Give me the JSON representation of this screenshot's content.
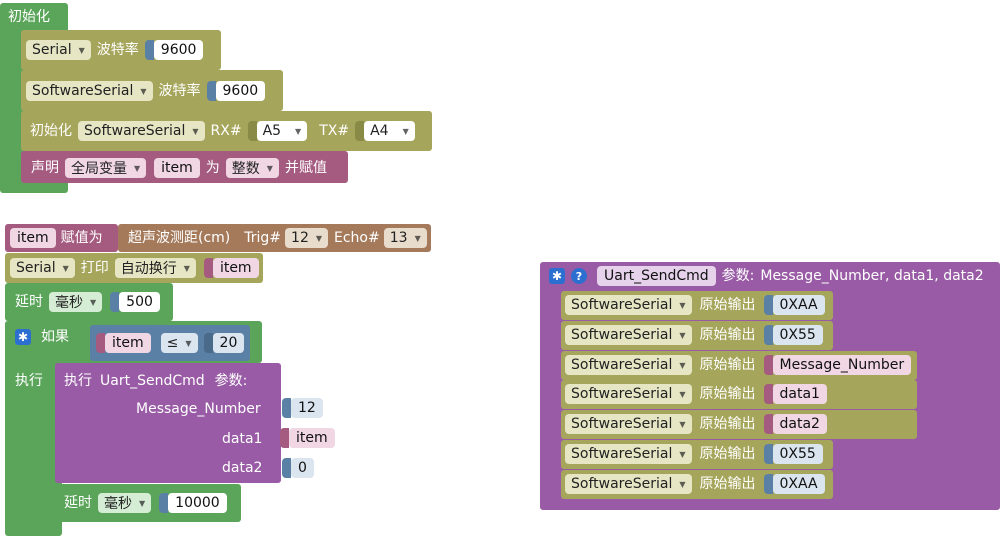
{
  "colors": {
    "green": "#5ba55b",
    "olive": "#a5a55b",
    "maroon": "#a55b80",
    "purple": "#995ba5",
    "blue_gray": "#5b80a5",
    "dark_olive": "#8a8a47",
    "brown": "#a57a5b",
    "white": "#ffffff"
  },
  "setup": {
    "title": "初始化",
    "serial_dd": "Serial",
    "baud_label": "波特率",
    "serial_baud": "9600",
    "softserial_dd": "SoftwareSerial",
    "softserial_baud": "9600",
    "init_label": "初始化",
    "init_dd": "SoftwareSerial",
    "rx_label": "RX#",
    "rx_value": "A5",
    "tx_label": "TX#",
    "tx_value": "A4",
    "declare_label": "声明",
    "scope_dd": "全局变量",
    "var_name": "item",
    "as_label": "为",
    "type_dd": "整数",
    "assign_label": "并赋值"
  },
  "loop": {
    "item_var": "item",
    "assign_label": "赋值为",
    "ultrasonic_label": "超声波测距(cm)",
    "trig_label": "Trig#",
    "trig_value": "12",
    "echo_label": "Echo#",
    "echo_value": "13",
    "print_serial_dd": "Serial",
    "print_label": "打印",
    "newline_dd": "自动换行",
    "print_var": "item",
    "delay_label": "延时",
    "delay_unit": "毫秒",
    "delay_value": "500",
    "if_label": "如果",
    "cond_var": "item",
    "cond_op": "≤",
    "cond_value": "20",
    "do_label": "执行",
    "call_label": "执行",
    "call_name": "Uart_SendCmd",
    "params_label": "参数:",
    "arg1_label": "Message_Number",
    "arg1_value": "12",
    "arg2_label": "data1",
    "arg2_value": "item",
    "arg3_label": "data2",
    "arg3_value": "0",
    "delay2_label": "延时",
    "delay2_unit": "毫秒",
    "delay2_value": "10000"
  },
  "func": {
    "name": "Uart_SendCmd",
    "params_label": "参数:",
    "params": "Message_Number, data1, data2",
    "rows": [
      {
        "serial": "SoftwareSerial",
        "label": "原始输出",
        "value": "0XAA",
        "kind": "number"
      },
      {
        "serial": "SoftwareSerial",
        "label": "原始输出",
        "value": "0X55",
        "kind": "number"
      },
      {
        "serial": "SoftwareSerial",
        "label": "原始输出",
        "value": "Message_Number",
        "kind": "var"
      },
      {
        "serial": "SoftwareSerial",
        "label": "原始输出",
        "value": "data1",
        "kind": "var"
      },
      {
        "serial": "SoftwareSerial",
        "label": "原始输出",
        "value": "data2",
        "kind": "var"
      },
      {
        "serial": "SoftwareSerial",
        "label": "原始输出",
        "value": "0X55",
        "kind": "number"
      },
      {
        "serial": "SoftwareSerial",
        "label": "原始输出",
        "value": "0XAA",
        "kind": "number"
      }
    ]
  }
}
